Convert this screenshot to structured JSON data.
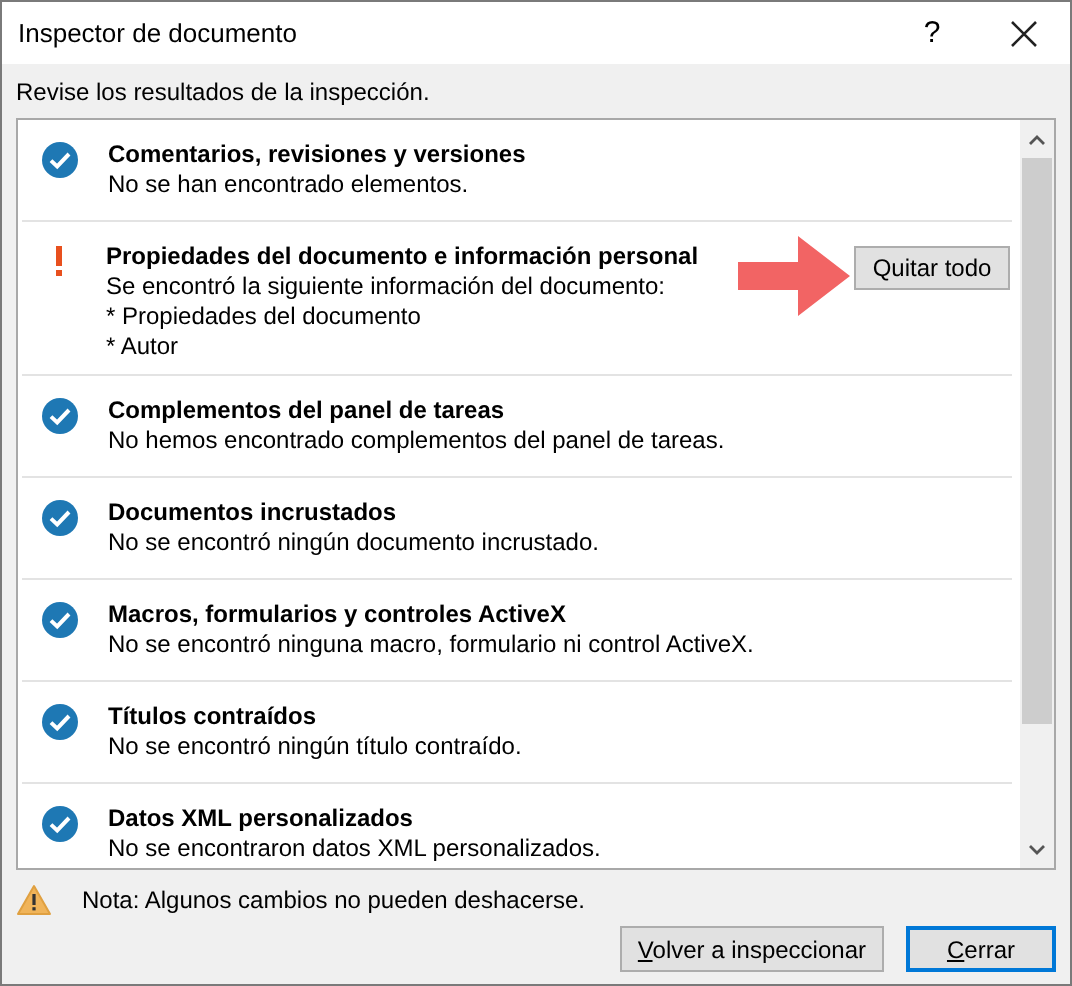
{
  "window": {
    "title": "Inspector de documento",
    "help": "?"
  },
  "instruction": "Revise los resultados de la inspección.",
  "results": [
    {
      "kind": "ok",
      "title": "Comentarios, revisiones y versiones",
      "lines": [
        "No se han encontrado elementos."
      ]
    },
    {
      "kind": "issue",
      "title": "Propiedades del documento e información personal",
      "lines": [
        "Se encontró la siguiente información del documento:",
        "* Propiedades del documento",
        "* Autor"
      ],
      "action": "Quitar todo"
    },
    {
      "kind": "ok",
      "title": "Complementos del panel de tareas",
      "lines": [
        "No hemos encontrado complementos del panel de tareas."
      ]
    },
    {
      "kind": "ok",
      "title": "Documentos incrustados",
      "lines": [
        "No se encontró ningún documento incrustado."
      ]
    },
    {
      "kind": "ok",
      "title": "Macros, formularios y controles ActiveX",
      "lines": [
        "No se encontró ninguna macro, formulario ni control ActiveX."
      ]
    },
    {
      "kind": "ok",
      "title": "Títulos contraídos",
      "lines": [
        "No se encontró ningún título contraído."
      ]
    },
    {
      "kind": "ok",
      "title": "Datos XML personalizados",
      "lines": [
        "No se encontraron datos XML personalizados."
      ]
    }
  ],
  "note": "Nota: Algunos cambios no pueden deshacerse.",
  "buttons": [
    {
      "label": "Volver a inspeccionar",
      "default": false
    },
    {
      "label": "Cerrar",
      "default": true
    }
  ]
}
